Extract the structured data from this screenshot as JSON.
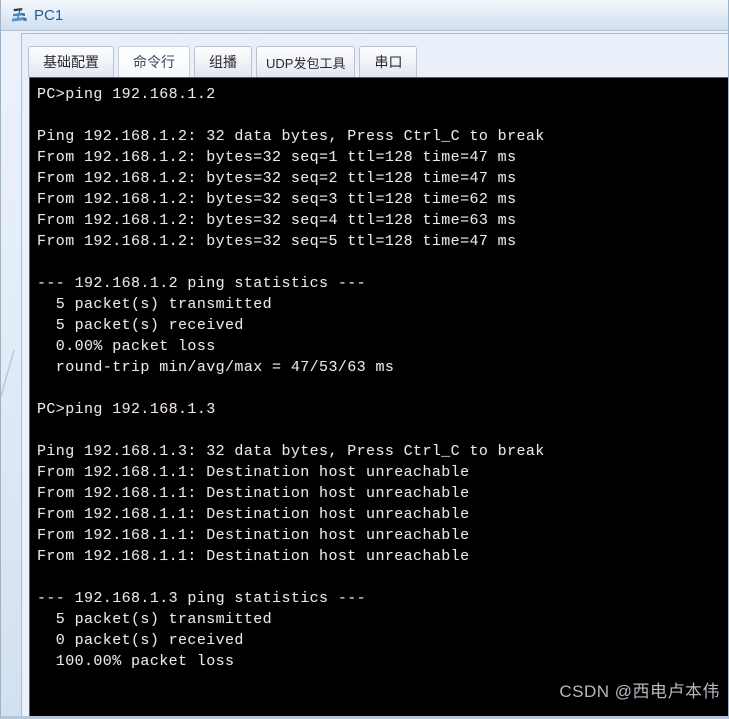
{
  "window": {
    "title": "PC1",
    "icon": "pc-device-icon"
  },
  "tabs": [
    {
      "label": "基础配置",
      "selected": false,
      "name": "tab-basic-config"
    },
    {
      "label": "命令行",
      "selected": true,
      "name": "tab-command-line"
    },
    {
      "label": "组播",
      "selected": false,
      "name": "tab-multicast"
    },
    {
      "label": "UDP发包工具",
      "selected": false,
      "name": "tab-udp-packet-tool"
    },
    {
      "label": "串口",
      "selected": false,
      "name": "tab-serial-port"
    }
  ],
  "terminal": {
    "text": "PC>ping 192.168.1.2\n\nPing 192.168.1.2: 32 data bytes, Press Ctrl_C to break\nFrom 192.168.1.2: bytes=32 seq=1 ttl=128 time=47 ms\nFrom 192.168.1.2: bytes=32 seq=2 ttl=128 time=47 ms\nFrom 192.168.1.2: bytes=32 seq=3 ttl=128 time=62 ms\nFrom 192.168.1.2: bytes=32 seq=4 ttl=128 time=63 ms\nFrom 192.168.1.2: bytes=32 seq=5 ttl=128 time=47 ms\n\n--- 192.168.1.2 ping statistics ---\n  5 packet(s) transmitted\n  5 packet(s) received\n  0.00% packet loss\n  round-trip min/avg/max = 47/53/63 ms\n\nPC>ping 192.168.1.3\n\nPing 192.168.1.3: 32 data bytes, Press Ctrl_C to break\nFrom 192.168.1.1: Destination host unreachable\nFrom 192.168.1.1: Destination host unreachable\nFrom 192.168.1.1: Destination host unreachable\nFrom 192.168.1.1: Destination host unreachable\nFrom 192.168.1.1: Destination host unreachable\n\n--- 192.168.1.3 ping statistics ---\n  5 packet(s) transmitted\n  0 packet(s) received\n  100.00% packet loss",
    "prompt": "PC>",
    "commands": [
      "ping 192.168.1.2",
      "ping 192.168.1.3"
    ],
    "sessions": [
      {
        "target": "192.168.1.2",
        "data_bytes": 32,
        "break_hint": "Press Ctrl_C to break",
        "replies": [
          {
            "from": "192.168.1.2",
            "bytes": 32,
            "seq": 1,
            "ttl": 128,
            "time_ms": 47
          },
          {
            "from": "192.168.1.2",
            "bytes": 32,
            "seq": 2,
            "ttl": 128,
            "time_ms": 47
          },
          {
            "from": "192.168.1.2",
            "bytes": 32,
            "seq": 3,
            "ttl": 128,
            "time_ms": 62
          },
          {
            "from": "192.168.1.2",
            "bytes": 32,
            "seq": 4,
            "ttl": 128,
            "time_ms": 63
          },
          {
            "from": "192.168.1.2",
            "bytes": 32,
            "seq": 5,
            "ttl": 128,
            "time_ms": 47
          }
        ],
        "statistics": {
          "header": "--- 192.168.1.2 ping statistics ---",
          "transmitted": "5 packet(s) transmitted",
          "received": "5 packet(s) received",
          "loss": "0.00% packet loss",
          "round_trip": "round-trip min/avg/max = 47/53/63 ms"
        }
      },
      {
        "target": "192.168.1.3",
        "data_bytes": 32,
        "break_hint": "Press Ctrl_C to break",
        "replies": [
          {
            "from": "192.168.1.1",
            "message": "Destination host unreachable"
          },
          {
            "from": "192.168.1.1",
            "message": "Destination host unreachable"
          },
          {
            "from": "192.168.1.1",
            "message": "Destination host unreachable"
          },
          {
            "from": "192.168.1.1",
            "message": "Destination host unreachable"
          },
          {
            "from": "192.168.1.1",
            "message": "Destination host unreachable"
          }
        ],
        "statistics": {
          "header": "--- 192.168.1.3 ping statistics ---",
          "transmitted": "5 packet(s) transmitted",
          "received": "0 packet(s) received",
          "loss": "100.00% packet loss"
        }
      }
    ]
  },
  "watermark": {
    "text": "CSDN @西电卢本伟"
  },
  "colors": {
    "title_text": "#1d5c9e",
    "terminal_bg": "#000000",
    "terminal_fg": "#e8e8e8",
    "frame": "#d3e0ef",
    "watermark": "#cdd2da"
  }
}
